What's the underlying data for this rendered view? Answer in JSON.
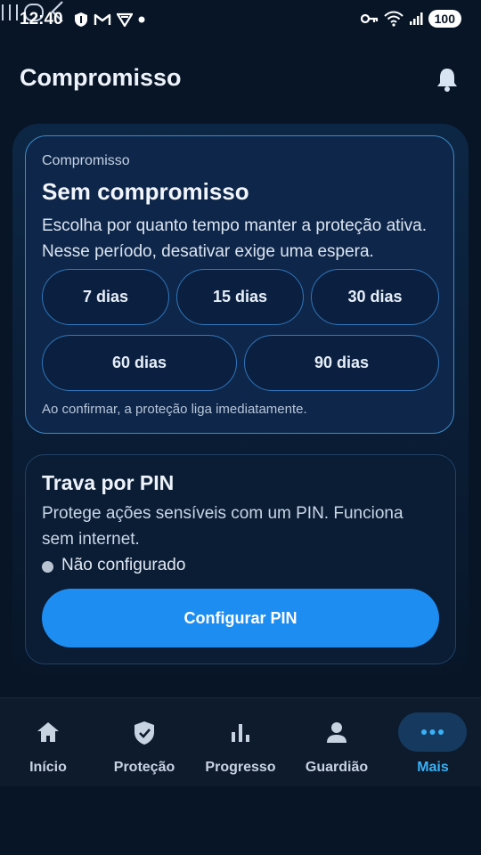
{
  "status_bar": {
    "time": "12:40",
    "battery": "100"
  },
  "header": {
    "title": "Compromisso",
    "notification_icon": "bell-icon"
  },
  "commitment_card": {
    "eyebrow": "Compromisso",
    "title": "Sem compromisso",
    "description": "Escolha por quanto tempo manter a proteção ativa. Nesse período, desativar exige uma espera.",
    "options": [
      "7 dias",
      "15 dias",
      "30 dias",
      "60 dias",
      "90 dias"
    ],
    "footnote": "Ao confirmar, a proteção liga imediatamente."
  },
  "pin_card": {
    "title": "Trava por PIN",
    "description": "Protege ações sensíveis com um PIN. Funciona sem internet.",
    "status": "Não configurado",
    "button": "Configurar PIN"
  },
  "bottom_nav": {
    "items": [
      {
        "label": "Início",
        "icon": "home-icon"
      },
      {
        "label": "Proteção",
        "icon": "shield-check-icon"
      },
      {
        "label": "Progresso",
        "icon": "bar-chart-icon"
      },
      {
        "label": "Guardião",
        "icon": "person-icon"
      },
      {
        "label": "Mais",
        "icon": "more-dots-icon"
      }
    ],
    "active_index": 4
  },
  "colors": {
    "accent": "#1e8df2",
    "active_nav": "#3ab0f5",
    "background": "#081526"
  }
}
